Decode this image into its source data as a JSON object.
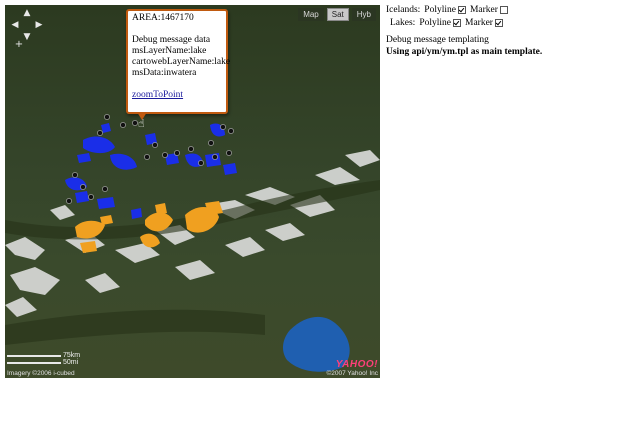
{
  "map": {
    "maptypes": [
      {
        "label": "Map",
        "active": false
      },
      {
        "label": "Sat",
        "active": true
      },
      {
        "label": "Hyb",
        "active": false
      }
    ],
    "popup": {
      "area": "AREA:1467170",
      "lines": [
        "Debug message data",
        "msLayerName:lake",
        "cartowebLayerName:lake",
        "msData:inwatera"
      ],
      "link": "zoomToPoint"
    },
    "scale": {
      "km": "75km",
      "mi": "50mi"
    },
    "copyright_left": "Imagery ©2006 i-cubed",
    "copyright_right": "©2007 Yahoo! Inc",
    "logo": "YAHOO!",
    "colors": {
      "lakes": "#1a2ee8",
      "icelands": "#f0a020",
      "popup_border": "#c05a10"
    }
  },
  "panel": {
    "icelands": {
      "label": "Icelands:",
      "polyline_label": "Polyline",
      "polyline_checked": true,
      "marker_label": "Marker",
      "marker_checked": false
    },
    "lakes": {
      "label": "Lakes:",
      "polyline_label": "Polyline",
      "polyline_checked": true,
      "marker_label": "Marker",
      "marker_checked": true
    },
    "debug_text": "Debug message templating",
    "template_text": "Using api/ym/ym.tpl as main template."
  }
}
